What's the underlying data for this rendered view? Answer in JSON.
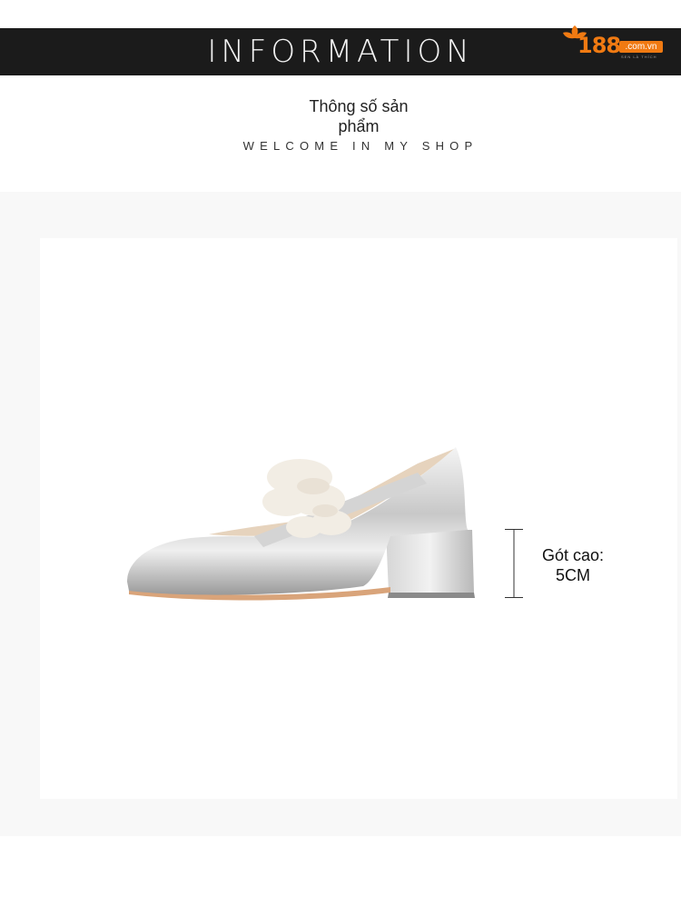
{
  "banner": {
    "title": "INFORMATION"
  },
  "logo": {
    "icon": "orange-leaf-icon",
    "number": "188",
    "domain": ".com.vn",
    "tagline": "SEN LÀ THÍCH",
    "accent_color": "#f07a12"
  },
  "heading": {
    "line1": "Thông số sản",
    "line2": "phẩm",
    "welcome": "WELCOME IN MY SHOP"
  },
  "product": {
    "image": "silver-mary-jane-shoe-with-fur",
    "heel_label_line1": "Gót cao:",
    "heel_label_line2": "5CM"
  }
}
